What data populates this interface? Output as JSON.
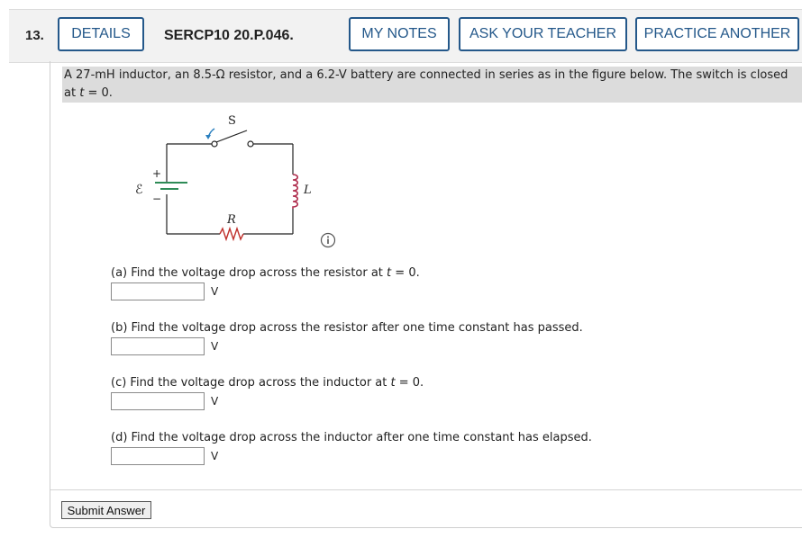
{
  "header": {
    "question_number": "13.",
    "details_label": "DETAILS",
    "question_id": "SERCP10 20.P.046.",
    "my_notes_label": "MY NOTES",
    "ask_teacher_label": "ASK YOUR TEACHER",
    "practice_label": "PRACTICE ANOTHER"
  },
  "problem": {
    "text_line1": "A 27-mH inductor, an 8.5-Ω resistor, and a 6.2-V battery are connected in series as in the figure below. The switch is closed",
    "text_line2_prefix": "at ",
    "text_line2_var": "t",
    "text_line2_suffix": " = 0."
  },
  "figure": {
    "switch_label": "S",
    "emf_label": "ℰ",
    "plus_label": "+",
    "minus_label": "−",
    "inductor_label": "L",
    "resistor_label": "R",
    "info_icon": "info-icon"
  },
  "parts": [
    {
      "prefix": "(a) Find the voltage drop across the resistor at ",
      "var": "t",
      "suffix": " = 0.",
      "value": "",
      "unit": "V"
    },
    {
      "prefix": "(b) Find the voltage drop across the resistor after one time constant has passed.",
      "var": "",
      "suffix": "",
      "value": "",
      "unit": "V"
    },
    {
      "prefix": "(c) Find the voltage drop across the inductor at ",
      "var": "t",
      "suffix": " = 0.",
      "value": "",
      "unit": "V"
    },
    {
      "prefix": "(d) Find the voltage drop across the inductor after one time constant has elapsed.",
      "var": "",
      "suffix": "",
      "value": "",
      "unit": "V"
    }
  ],
  "submit_label": "Submit Answer",
  "colors": {
    "accent": "#24588a",
    "battery_plate": "#2e8b57",
    "switch_arrow": "#2a7fbf"
  }
}
